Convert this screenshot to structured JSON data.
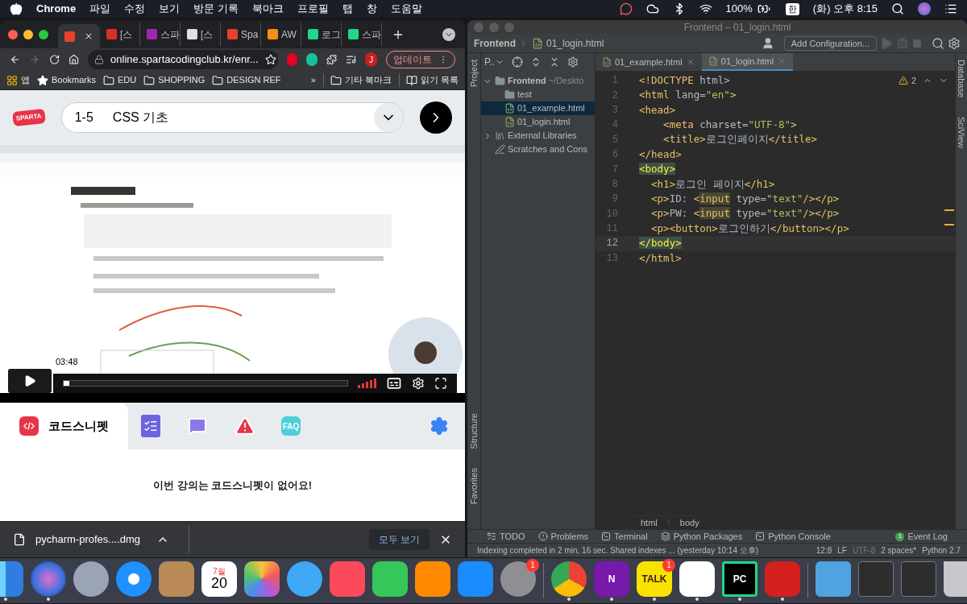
{
  "menu_bar": {
    "app": "Chrome",
    "menus": [
      "파일",
      "수정",
      "보기",
      "방문 기록",
      "북마크",
      "프로필",
      "탭",
      "창",
      "도움말"
    ],
    "battery": "100%",
    "input_source": "한",
    "clock": "(화) 오후 8:15"
  },
  "browser": {
    "tabs": [
      {
        "selected": true,
        "color": "#e8412c"
      },
      {
        "title": "[스",
        "selected": false,
        "color": "#d93025"
      },
      {
        "title": "스파",
        "selected": false,
        "color": "#9c27b0"
      },
      {
        "title": "[스",
        "selected": false,
        "color": "#e0e0e0"
      },
      {
        "title": "Spa",
        "selected": false,
        "color": "#e8412c"
      },
      {
        "title": "AW",
        "selected": false,
        "color": "#f29111"
      },
      {
        "title": "로그",
        "selected": false,
        "color": "#21d789"
      },
      {
        "title": "스파",
        "selected": false,
        "color": "#21d789"
      }
    ],
    "forward_disabled": true,
    "address": "online.spartacodingclub.kr/enr...",
    "profile_initial": "J",
    "update_button": "업데이트",
    "bookmarks": [
      {
        "kind": "apps",
        "label": "앱"
      },
      {
        "kind": "star",
        "label": "Bookmarks"
      },
      {
        "kind": "folder",
        "label": "EDU"
      },
      {
        "kind": "folder",
        "label": "SHOPPING"
      },
      {
        "kind": "folder",
        "label": "DESIGN REF"
      }
    ],
    "bookmarks_overflow": "»",
    "bookmarks_right": [
      {
        "kind": "folder",
        "label": "기타 북마크"
      },
      {
        "kind": "reading",
        "label": "읽기 목록"
      }
    ]
  },
  "lesson": {
    "logo": "SPARTA",
    "number": "1-5",
    "title": "CSS 기초"
  },
  "video": {
    "kind": "picture",
    "time": "03:48",
    "level": 0.02
  },
  "snippet_panel": {
    "tabs": [
      {
        "kind": "snippet",
        "label": "코드스니펫",
        "selected": true
      },
      {
        "kind": "checklist",
        "selected": false
      },
      {
        "kind": "chat",
        "selected": false
      },
      {
        "kind": "warning",
        "selected": false
      },
      {
        "kind": "faq",
        "label": "FAQ",
        "selected": false
      }
    ],
    "message": "이번 강의는 코드스니펫이 없어요!"
  },
  "downloads": {
    "file": "pycharm-profes....dmg",
    "show_all": "모두 보기"
  },
  "ide": {
    "title": "Frontend – 01_login.html",
    "breadcrumb": [
      "Frontend",
      "01_login.html"
    ],
    "run_config": "Add Configuration...",
    "project_view": "P..",
    "tree": [
      {
        "kind": "folder",
        "label": "Frontend",
        "hint": "~/Deskto",
        "expanded": true,
        "selected": false,
        "children": [
          {
            "kind": "folder",
            "label": "test",
            "selected": false
          },
          {
            "kind": "html",
            "label": "01_example.html",
            "selected": true
          },
          {
            "kind": "html",
            "label": "01_login.html",
            "selected": false
          }
        ]
      },
      {
        "kind": "library",
        "label": "External Libraries",
        "expanded": false,
        "selected": false
      },
      {
        "kind": "scratch",
        "label": "Scratches and Cons",
        "selected": false
      }
    ],
    "editor_tabs": [
      {
        "label": "01_example.html",
        "selected": false
      },
      {
        "label": "01_login.html",
        "selected": true
      }
    ],
    "warning_count": "2",
    "lines": [
      {
        "number": "1",
        "current": false,
        "tokens": [
          {
            "kind": "tag",
            "text": "<!DOCTYPE"
          },
          {
            "kind": "text",
            "text": " html>"
          }
        ]
      },
      {
        "number": "2",
        "current": false,
        "tokens": [
          {
            "kind": "tag",
            "text": "<html"
          },
          {
            "kind": "attr",
            "text": " lang="
          },
          {
            "kind": "string",
            "text": "\"en\""
          },
          {
            "kind": "tag",
            "text": ">"
          }
        ]
      },
      {
        "number": "3",
        "current": false,
        "tokens": [
          {
            "kind": "tag",
            "text": "<head>"
          }
        ]
      },
      {
        "number": "4",
        "current": false,
        "tokens": [
          {
            "kind": "tag",
            "text": "    <meta"
          },
          {
            "kind": "attr",
            "text": " charset="
          },
          {
            "kind": "string",
            "text": "\"UTF-8\""
          },
          {
            "kind": "tag",
            "text": ">"
          }
        ]
      },
      {
        "number": "5",
        "current": false,
        "tokens": [
          {
            "kind": "tag",
            "text": "    <title>"
          },
          {
            "kind": "text",
            "text": "로그인페이지"
          },
          {
            "kind": "tag",
            "text": "</title>"
          }
        ]
      },
      {
        "number": "6",
        "current": false,
        "tokens": [
          {
            "kind": "tag",
            "text": "</head>"
          }
        ]
      },
      {
        "number": "7",
        "current": false,
        "tokens": [
          {
            "kind": "match",
            "text": "<body>"
          }
        ]
      },
      {
        "number": "8",
        "current": false,
        "tokens": [
          {
            "kind": "tag",
            "text": "  <h1>"
          },
          {
            "kind": "text",
            "text": "로그인 페이지"
          },
          {
            "kind": "tag",
            "text": "</h1>"
          }
        ]
      },
      {
        "number": "9",
        "current": false,
        "tokens": [
          {
            "kind": "tag",
            "text": "  <p>"
          },
          {
            "kind": "text",
            "text": "ID: "
          },
          {
            "kind": "tag",
            "text": "<"
          },
          {
            "kind": "warn",
            "text": "input"
          },
          {
            "kind": "attr",
            "text": " type="
          },
          {
            "kind": "string",
            "text": "\"text\""
          },
          {
            "kind": "tag",
            "text": "/></p>"
          }
        ]
      },
      {
        "number": "10",
        "current": false,
        "tokens": [
          {
            "kind": "tag",
            "text": "  <p>"
          },
          {
            "kind": "text",
            "text": "PW: "
          },
          {
            "kind": "tag",
            "text": "<"
          },
          {
            "kind": "warn",
            "text": "input"
          },
          {
            "kind": "attr",
            "text": " type="
          },
          {
            "kind": "string",
            "text": "\"text\""
          },
          {
            "kind": "tag",
            "text": "/></p>"
          }
        ]
      },
      {
        "number": "11",
        "current": false,
        "tokens": [
          {
            "kind": "tag",
            "text": "  <p><button>"
          },
          {
            "kind": "text",
            "text": "로그인하기"
          },
          {
            "kind": "tag",
            "text": "</button></p>"
          }
        ]
      },
      {
        "number": "12",
        "current": true,
        "tokens": [
          {
            "kind": "match",
            "text": "</body>"
          }
        ]
      },
      {
        "number": "13",
        "current": false,
        "tokens": [
          {
            "kind": "tag",
            "text": "</html>"
          }
        ]
      }
    ],
    "path": [
      "html",
      "body"
    ],
    "left_stripe_top": "Project",
    "left_stripe_bottom": [
      "Structure",
      "Favorites"
    ],
    "right_stripe": [
      "Database",
      "SciView"
    ],
    "tool_windows": [
      {
        "kind": "todo",
        "label": "TODO"
      },
      {
        "kind": "problems",
        "label": "Problems"
      },
      {
        "kind": "terminal",
        "label": "Terminal"
      },
      {
        "kind": "packages",
        "label": "Python Packages"
      },
      {
        "kind": "console",
        "label": "Python Console"
      }
    ],
    "event_log": {
      "label": "Event Log",
      "badge": "1"
    },
    "status": {
      "message": "Indexing completed in 2 min, 16 sec. Shared indexes ... (yesterday 10:14 오후)",
      "position": "12:8",
      "line_ending": "LF",
      "encoding": "UTF-8",
      "indent": "2 spaces*",
      "interpreter": "Python 2.7"
    }
  },
  "dock": [
    {
      "kind": "finder",
      "running": true
    },
    {
      "kind": "siri",
      "running": true
    },
    {
      "kind": "launchpad",
      "running": false
    },
    {
      "kind": "safari",
      "running": false
    },
    {
      "kind": "notes",
      "running": false
    },
    {
      "kind": "calendar",
      "month": "7월",
      "day": "20",
      "running": false
    },
    {
      "kind": "photos",
      "running": false
    },
    {
      "kind": "messages",
      "running": false
    },
    {
      "kind": "music",
      "running": false
    },
    {
      "kind": "facetime",
      "running": false
    },
    {
      "kind": "books",
      "running": false
    },
    {
      "kind": "appstore",
      "running": false
    },
    {
      "kind": "settings",
      "badge": "1",
      "running": false
    },
    {
      "kind": "separator"
    },
    {
      "kind": "chrome",
      "running": true
    },
    {
      "kind": "onenote",
      "label": "N",
      "running": true
    },
    {
      "kind": "kakaotalk",
      "label": "TALK",
      "badge": "1",
      "running": true
    },
    {
      "kind": "slack",
      "running": true
    },
    {
      "kind": "pycharm",
      "label": "PC",
      "running": true
    },
    {
      "kind": "acrobat",
      "running": true
    },
    {
      "kind": "separator"
    },
    {
      "kind": "folder",
      "running": false
    },
    {
      "kind": "screenshot",
      "running": false
    },
    {
      "kind": "screenshot",
      "running": false
    },
    {
      "kind": "trash",
      "running": false
    }
  ]
}
